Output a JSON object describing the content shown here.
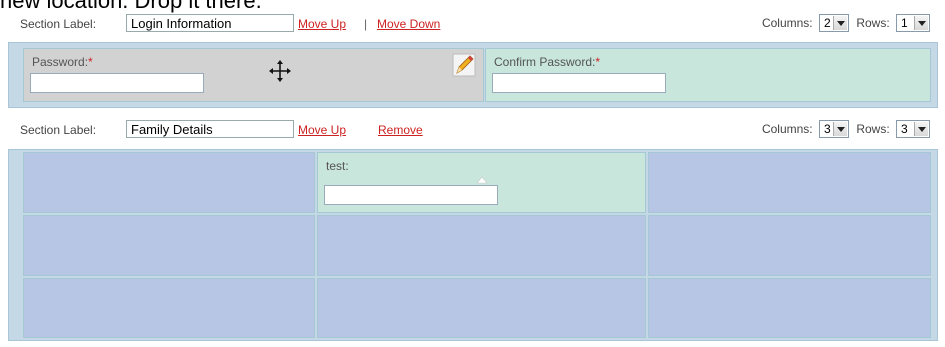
{
  "caption": "new location. Drop it there.",
  "sections": [
    {
      "section_label_text": "Section Label:",
      "label_value": "Login Information",
      "links": {
        "move_up": "Move Up",
        "separator": "|",
        "move_down": "Move Down"
      },
      "columns_label": "Columns:",
      "columns_value": "2",
      "rows_label": "Rows:",
      "rows_value": "1",
      "fields": [
        {
          "label": "Password:",
          "required_mark": "*",
          "state": "dragging"
        },
        {
          "label": "Confirm Password:",
          "required_mark": "*",
          "state": "normal"
        }
      ]
    },
    {
      "section_label_text": "Section Label:",
      "label_value": "Family Details",
      "links": {
        "move_up": "Move Up",
        "remove": "Remove"
      },
      "columns_label": "Columns:",
      "columns_value": "3",
      "rows_label": "Rows:",
      "rows_value": "3",
      "fields": [
        {
          "label": "test:",
          "required_mark": "",
          "state": "normal"
        }
      ]
    }
  ],
  "icons": {
    "move": "move-arrows-icon",
    "edit": "pencil-icon",
    "dropdown": "chevron-down-icon",
    "cursor": "cursor-caret-icon"
  },
  "colors": {
    "link": "#cc2222",
    "filled_cell": "#c8e6dc",
    "empty_cell": "#b6c6e4",
    "dragging_cell": "#d2d2d2",
    "grid_border": "#a9c6d8"
  }
}
